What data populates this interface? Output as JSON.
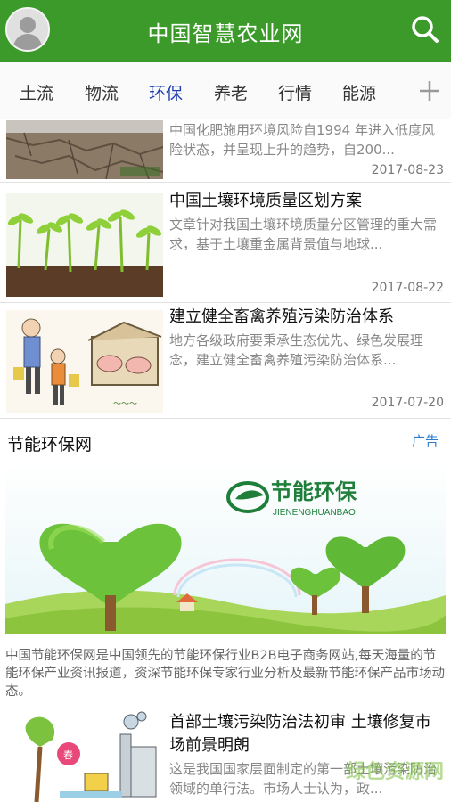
{
  "header": {
    "title": "中国智慧农业网",
    "accent_color": "#3b9a2a"
  },
  "tabs": [
    {
      "label": "土流"
    },
    {
      "label": "物流"
    },
    {
      "label": "环保",
      "active": true
    },
    {
      "label": "养老"
    },
    {
      "label": "行情"
    },
    {
      "label": "能源"
    }
  ],
  "news": [
    {
      "title": "",
      "desc": "中国化肥施用环境风险自1994 年进入低度风险状态，并呈现上升的趋势，自200...",
      "date": "2017-08-23"
    },
    {
      "title": "中国土壤环境质量区划方案",
      "desc": "文章针对我国土壤环境质量分区管理的重大需求，基于土壤重金属背景值与地球...",
      "date": "2017-08-22"
    },
    {
      "title": "建立健全畜禽养殖污染防治体系",
      "desc": "地方各级政府要秉承生态优先、绿色发展理念，建立健全畜禽养殖污染防治体系...",
      "date": "2017-07-20"
    },
    {
      "title": "首部土壤污染防治法初审 土壤修复市场前景明朗",
      "desc": "这是我国国家层面制定的第一部土壤污染防治领域的单行法。市场人士认为，政..."
    }
  ],
  "ad": {
    "title": "节能环保网",
    "label": "广告",
    "logo_text": "节能环保",
    "logo_sub": "JIENENGHUANBAO",
    "text": "中国节能环保网是中国领先的节能环保行业B2B电子商务网站,每天海量的节能环保产业资讯报道，资深节能环保专家行业分析及最新节能环保产品市场动态。"
  },
  "icons": {
    "avatar": "avatar-icon",
    "search": "search-icon",
    "add": "plus-icon"
  },
  "watermark": "绿色资源网"
}
